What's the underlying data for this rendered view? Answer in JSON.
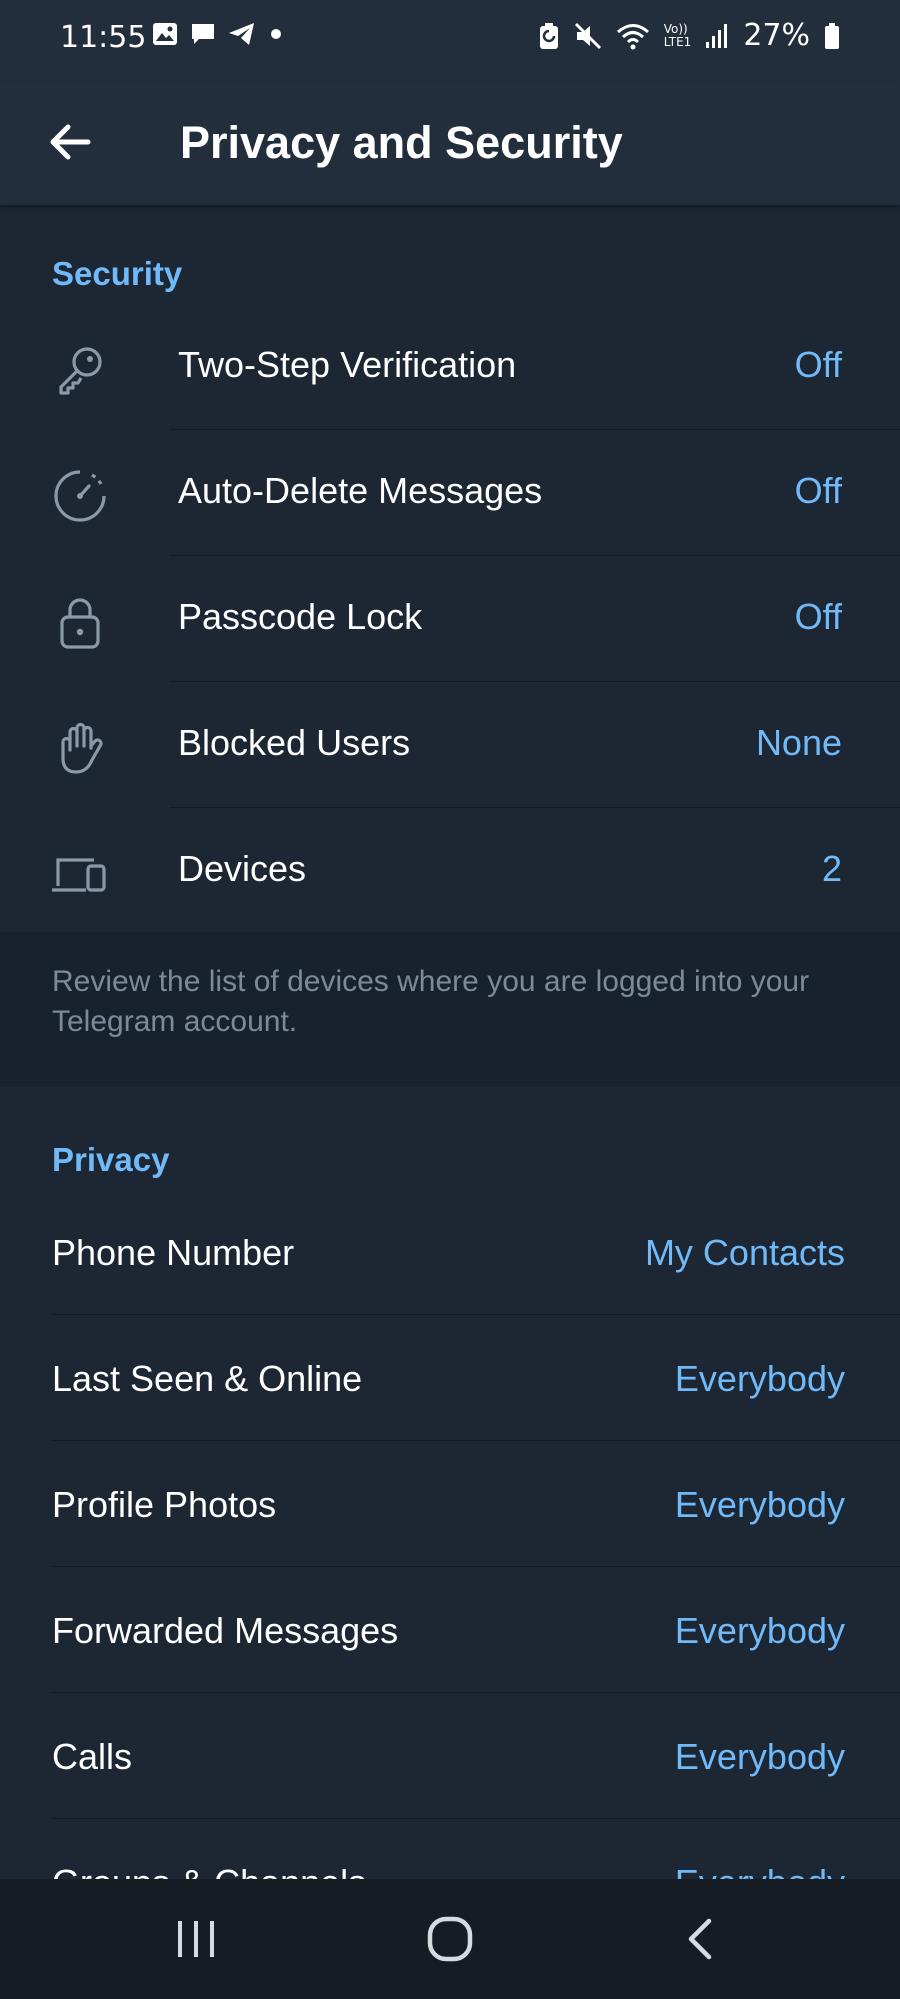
{
  "status_bar": {
    "time": "11:55",
    "battery_percent": "27%",
    "left_icons": [
      "gallery-icon",
      "message-icon",
      "telegram-icon",
      "dot-icon"
    ],
    "right_icons": [
      "battery-saver-icon",
      "mute-icon",
      "wifi-icon",
      "volte-icon",
      "signal-icon",
      "battery-icon"
    ],
    "volte_label": "Vo))",
    "lte_label": "LTE1"
  },
  "toolbar": {
    "title": "Privacy and Security",
    "back_icon": "back-arrow-icon"
  },
  "security": {
    "header": "Security",
    "items": [
      {
        "label": "Two-Step Verification",
        "value": "Off",
        "icon": "key-icon"
      },
      {
        "label": "Auto-Delete Messages",
        "value": "Off",
        "icon": "timer-icon"
      },
      {
        "label": "Passcode Lock",
        "value": "Off",
        "icon": "lock-icon"
      },
      {
        "label": "Blocked Users",
        "value": "None",
        "icon": "hand-icon"
      },
      {
        "label": "Devices",
        "value": "2",
        "icon": "devices-icon"
      }
    ],
    "hint": "Review the list of devices where you are logged into your Telegram account."
  },
  "privacy": {
    "header": "Privacy",
    "items": [
      {
        "label": "Phone Number",
        "value": "My Contacts"
      },
      {
        "label": "Last Seen & Online",
        "value": "Everybody"
      },
      {
        "label": "Profile Photos",
        "value": "Everybody"
      },
      {
        "label": "Forwarded Messages",
        "value": "Everybody"
      },
      {
        "label": "Calls",
        "value": "Everybody"
      },
      {
        "label": "Groups & Channels",
        "value": "Everybody"
      }
    ]
  },
  "nav_bar": {
    "icons": [
      "recent-apps-icon",
      "home-icon",
      "back-icon"
    ]
  },
  "colors": {
    "background": "#1d2733",
    "toolbar": "#232e3c",
    "accent": "#71baf9",
    "hint_background": "#18222d",
    "hint_text": "#7d8b99"
  }
}
